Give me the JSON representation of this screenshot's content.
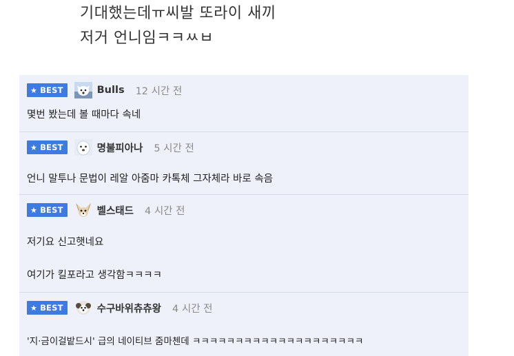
{
  "post": {
    "line1": "기대했는데ㅠ씨발 또라이 새끼",
    "line2": "저거 언니임ㅋㅋㅆㅂ"
  },
  "badge_label": "BEST",
  "icons": {
    "badge": "star-icon",
    "avatar_1": "white-dog-avatar-icon",
    "avatar_2": "white-dog-avatar-icon",
    "avatar_3": "chihuahua-avatar-icon",
    "avatar_4": "fluffy-dog-avatar-icon"
  },
  "colors": {
    "badge": "#3d7be0",
    "comments_bg": "#eef1fa",
    "timestamp": "#8a8a8a"
  },
  "comments": [
    {
      "nickname": "Bulls",
      "time": "12 시간 전",
      "lines": [
        "몇번 봤는데 볼 때마다 속네"
      ]
    },
    {
      "nickname": "명불피아나",
      "time": "5 시간 전",
      "lines": [
        "언니 말투나 문법이 레알 아줌마 카톡체 그자체라 바로 속음"
      ]
    },
    {
      "nickname": "벨스태드",
      "time": "4 시간 전",
      "lines": [
        "저기요 신고햇네요",
        "여기가 킬포라고 생각함ㅋㅋㅋㅋ"
      ]
    },
    {
      "nickname": "수구바위츄츄왕",
      "time": "4 시간 전",
      "lines": [
        "'지·금이걸밭드시' 급의 네이티브 줌마첸데 ㅋㅋㅋㅋㅋㅋㅋㅋㅋㅋㅋㅋㅋㅋㅋㅋㅋㅋㅋㅋ"
      ]
    }
  ]
}
